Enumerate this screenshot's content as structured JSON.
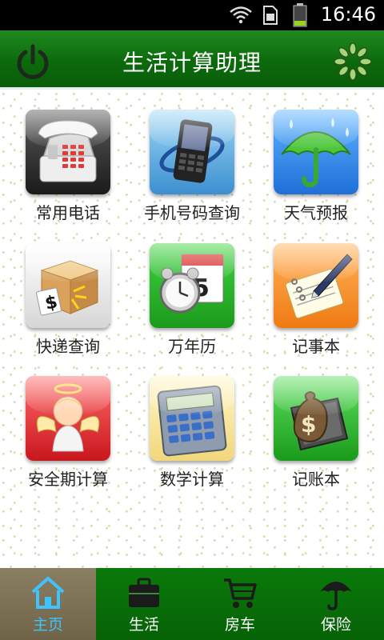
{
  "status_bar": {
    "time": "16:46"
  },
  "title_bar": {
    "title": "生活计算助理"
  },
  "tiles": [
    {
      "label": "常用电话",
      "icon": "telephone-icon"
    },
    {
      "label": "手机号码查询",
      "icon": "mobile-phone-icon"
    },
    {
      "label": "天气预报",
      "icon": "weather-umbrella-icon"
    },
    {
      "label": "快递查询",
      "icon": "package-icon"
    },
    {
      "label": "万年历",
      "icon": "calendar-clock-icon"
    },
    {
      "label": "记事本",
      "icon": "notepad-pen-icon"
    },
    {
      "label": "安全期计算",
      "icon": "angel-icon"
    },
    {
      "label": "数学计算",
      "icon": "calculator-icon"
    },
    {
      "label": "记账本",
      "icon": "money-bag-book-icon"
    }
  ],
  "bottom_nav": [
    {
      "label": "主页",
      "icon": "home-icon",
      "active": true
    },
    {
      "label": "生活",
      "icon": "briefcase-icon",
      "active": false
    },
    {
      "label": "房车",
      "icon": "shopping-cart-icon",
      "active": false
    },
    {
      "label": "保险",
      "icon": "umbrella-icon",
      "active": false
    }
  ],
  "colors": {
    "title_bar": "#0c6a0c",
    "nav_bar": "#066206",
    "active_tab": "#7a6f54",
    "active_label": "#3fc3ff"
  }
}
